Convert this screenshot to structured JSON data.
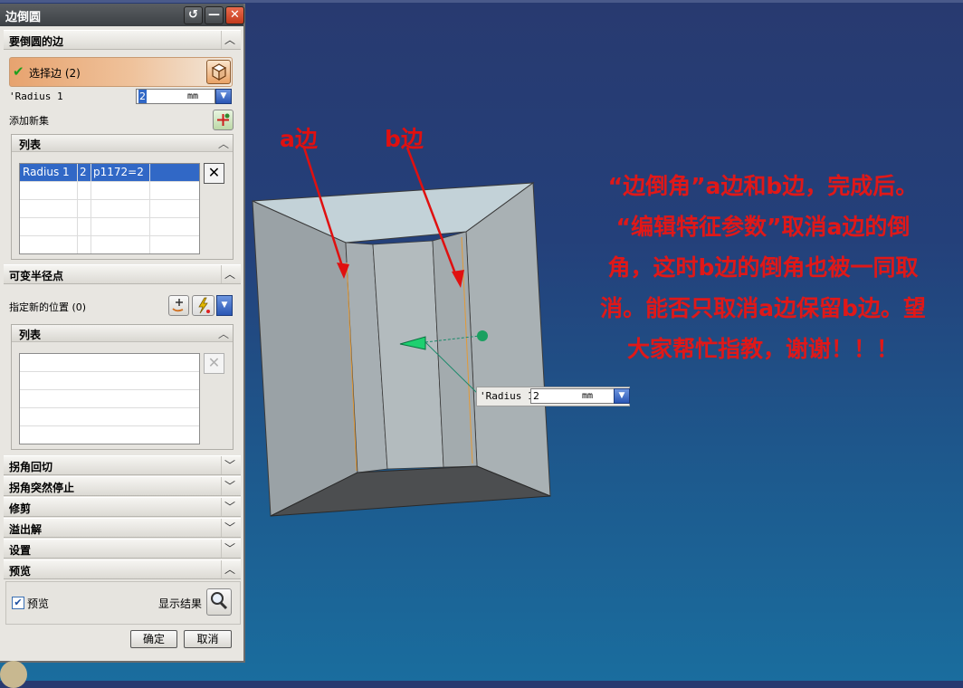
{
  "dialog": {
    "title": "边倒圆",
    "sections": {
      "edges": "要倒圆的边",
      "variable_radius": "可变半径点",
      "corner_setback": "拐角回切",
      "stop_short": "拐角突然停止",
      "trim": "修剪",
      "overflow": "溢出解",
      "settings": "设置",
      "preview": "预览"
    },
    "select_edge_label": "选择边 (2)",
    "radius_label": "'Radius 1",
    "radius_value": "2",
    "radius_unit": "mm",
    "add_new_set": "添加新集",
    "list_label": "列表",
    "list_rows": [
      {
        "name": "Radius 1",
        "num": "2",
        "expr": "p1172=2"
      }
    ],
    "specify_new_location": "指定新的位置 (0)",
    "variable_list_label": "列表",
    "preview_checkbox": "预览",
    "preview_checked": true,
    "show_result": "显示结果",
    "ok": "确定",
    "cancel": "取消"
  },
  "viewport": {
    "floating_radius_label": "'Radius 1",
    "floating_radius_value": "2",
    "floating_radius_unit": "mm",
    "label_a": "a边",
    "label_b": "b边",
    "note_lines": [
      "“边倒角”a边和b边，完成后。",
      "“编辑特征参数”取消a边的倒",
      "角，这时b边的倒角也被一同取",
      "消。能否只取消a边保留b边。望",
      "大家帮忙指教，谢谢！！！"
    ]
  },
  "colors": {
    "annotation_red": "#e01010",
    "selection_blue": "#3168c6",
    "select_orange": "#e7a36f"
  }
}
